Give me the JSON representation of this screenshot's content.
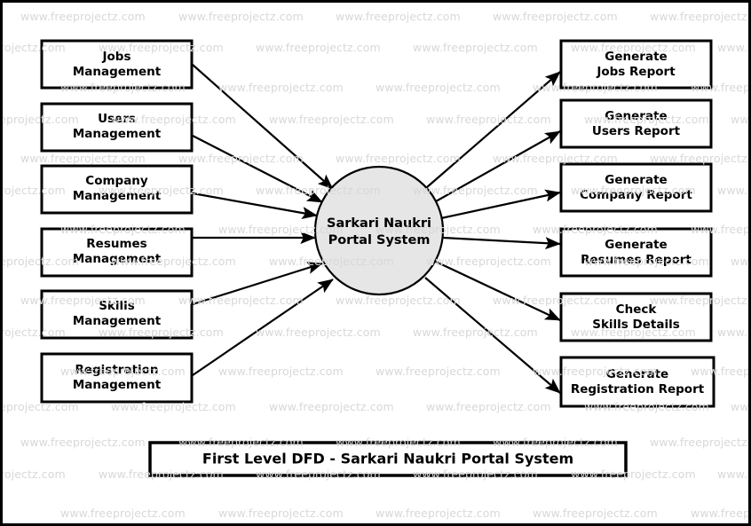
{
  "diagram": {
    "title": "First Level DFD - Sarkari Naukri Portal System",
    "process": {
      "name": "Sarkari Naukri Portal System",
      "line1": "Sarkari Naukri",
      "line2": "Portal System",
      "fill_color": "#e6e6e6",
      "stroke_color": "#000000"
    },
    "inputs": [
      {
        "line1": "Jobs",
        "line2": "Management",
        "label": "Jobs Management"
      },
      {
        "line1": "Users",
        "line2": "Management",
        "label": "Users Management"
      },
      {
        "line1": "Company",
        "line2": "Management",
        "label": "Company Management"
      },
      {
        "line1": "Resumes",
        "line2": "Management",
        "label": "Resumes Management"
      },
      {
        "line1": "Skills",
        "line2": "Management",
        "label": "Skills Management"
      },
      {
        "line1": "Registration",
        "line2": "Management",
        "label": "Registration Management"
      }
    ],
    "outputs": [
      {
        "line1": "Generate",
        "line2": "Jobs Report",
        "label": "Generate Jobs Report"
      },
      {
        "line1": "Generate",
        "line2": "Users Report",
        "label": "Generate Users Report"
      },
      {
        "line1": "Generate",
        "line2": "Company Report",
        "label": "Generate Company Report"
      },
      {
        "line1": "Generate",
        "line2": "Resumes Report",
        "label": "Generate Resumes Report"
      },
      {
        "line1": "Check",
        "line2": "Skills Details",
        "label": "Check Skills Details"
      },
      {
        "line1": "Generate",
        "line2": "Registration Report",
        "label": "Generate Registration Report"
      }
    ]
  },
  "watermark": {
    "text": "www.freeprojectz.com",
    "color": "#d8d8d8"
  }
}
